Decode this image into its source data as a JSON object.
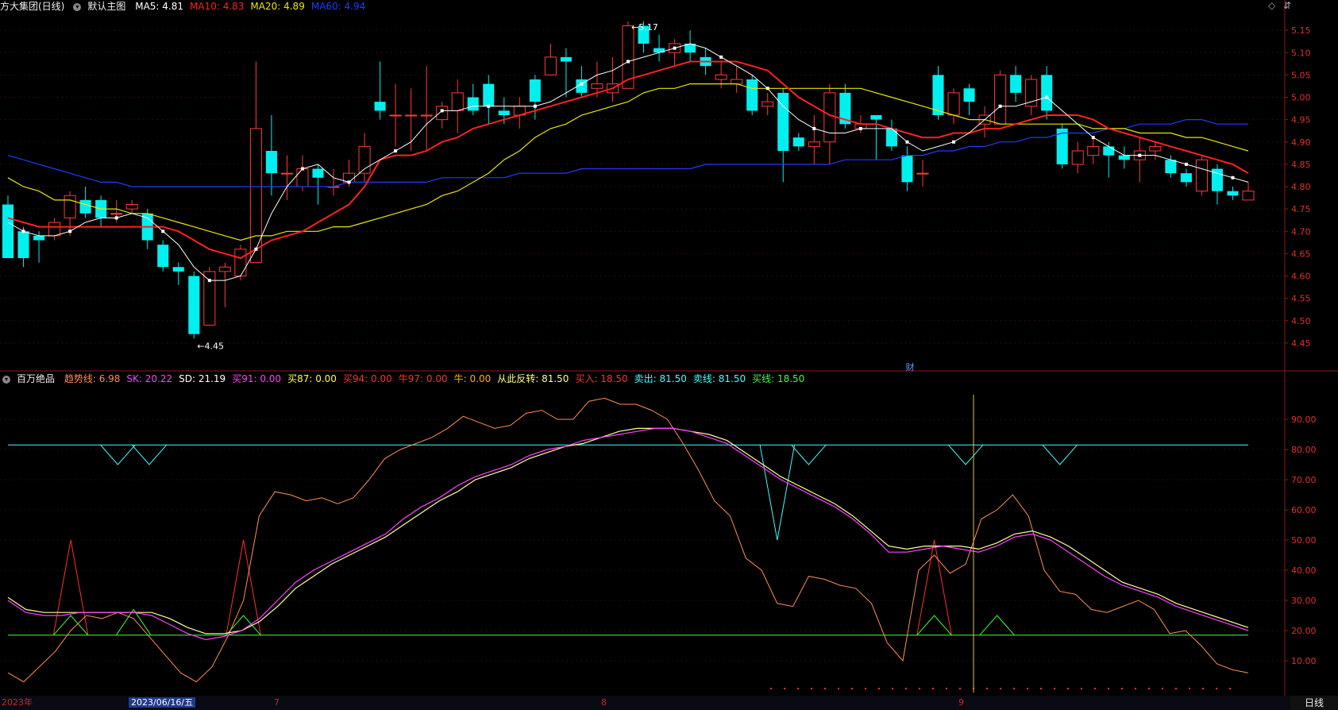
{
  "header_top": {
    "stock_title": "方大集团(日线)",
    "template_label": "默认主图",
    "ma_items": [
      {
        "text": "MA5: 4.81",
        "color": "#ffffff"
      },
      {
        "text": "MA10: 4.83",
        "color": "#ff2020"
      },
      {
        "text": "MA20: 4.89",
        "color": "#e8e800"
      },
      {
        "text": "MA60: 4.94",
        "color": "#1e3cff"
      }
    ],
    "icons": [
      "◇",
      "⇵"
    ]
  },
  "header_bottom": {
    "indicator_name": "百万绝品",
    "items": [
      {
        "text": "趋势线: 6.98",
        "color": "#ff8c5a"
      },
      {
        "text": "SK: 20.22",
        "color": "#ff40ff"
      },
      {
        "text": "SD: 21.19",
        "color": "#ffffff"
      },
      {
        "text": "买91: 0.00",
        "color": "#ff40ff"
      },
      {
        "text": "买87: 0.00",
        "color": "#ffff40"
      },
      {
        "text": "买94: 0.00",
        "color": "#ff3030"
      },
      {
        "text": "牛97: 0.00",
        "color": "#ff3030"
      },
      {
        "text": "牛: 0.00",
        "color": "#ffb000"
      },
      {
        "text": "从此反转: 81.50",
        "color": "#ffff80"
      },
      {
        "text": "买入: 18.50",
        "color": "#ff3030"
      },
      {
        "text": "卖出: 81.50",
        "color": "#40ffff"
      },
      {
        "text": "卖线: 81.50",
        "color": "#40ffff"
      },
      {
        "text": "买线: 18.50",
        "color": "#40ff40"
      }
    ]
  },
  "bottom_axis": {
    "labels": [
      "2023年",
      "2023/06/16/五",
      "7",
      "8",
      "9"
    ],
    "period_button": "日线"
  },
  "annotations": {
    "high": "5.17",
    "low": "4.45",
    "fin_marker": "财"
  },
  "chart_data": [
    {
      "type": "candlestick",
      "ylim": [
        4.4,
        5.2
      ],
      "y_ticks": [
        "5.15",
        "5.10",
        "5.05",
        "5.00",
        "4.95",
        "4.90",
        "4.85",
        "4.80",
        "4.75",
        "4.70",
        "4.65",
        "4.60",
        "4.55",
        "4.50",
        "4.45"
      ],
      "candles": [
        [
          4.76,
          4.64,
          4.78,
          4.64
        ],
        [
          4.7,
          4.64,
          4.71,
          4.62
        ],
        [
          4.69,
          4.68,
          4.7,
          4.63
        ],
        [
          4.69,
          4.72,
          4.73,
          4.68
        ],
        [
          4.73,
          4.78,
          4.79,
          4.69
        ],
        [
          4.77,
          4.74,
          4.8,
          4.73
        ],
        [
          4.77,
          4.73,
          4.78,
          4.71
        ],
        [
          4.74,
          4.74,
          4.77,
          4.72
        ],
        [
          4.75,
          4.76,
          4.77,
          4.74
        ],
        [
          4.74,
          4.68,
          4.75,
          4.66
        ],
        [
          4.67,
          4.62,
          4.68,
          4.61
        ],
        [
          4.62,
          4.61,
          4.63,
          4.58
        ],
        [
          4.6,
          4.47,
          4.61,
          4.46
        ],
        [
          4.49,
          4.61,
          4.62,
          4.49
        ],
        [
          4.61,
          4.62,
          4.63,
          4.53
        ],
        [
          4.6,
          4.66,
          4.67,
          4.59
        ],
        [
          4.63,
          4.93,
          5.08,
          4.63
        ],
        [
          4.88,
          4.83,
          4.96,
          4.78
        ],
        [
          4.83,
          4.83,
          4.87,
          4.77
        ],
        [
          4.8,
          4.84,
          4.87,
          4.79
        ],
        [
          4.84,
          4.82,
          4.85,
          4.76
        ],
        [
          4.8,
          4.8,
          4.84,
          4.78
        ],
        [
          4.81,
          4.83,
          4.86,
          4.8
        ],
        [
          4.83,
          4.89,
          4.92,
          4.81
        ],
        [
          4.99,
          4.97,
          5.08,
          4.95
        ],
        [
          4.96,
          4.96,
          5.03,
          4.89
        ],
        [
          4.96,
          4.96,
          5.02,
          4.88
        ],
        [
          4.96,
          4.96,
          5.07,
          4.88
        ],
        [
          4.95,
          4.98,
          4.99,
          4.93
        ],
        [
          4.97,
          5.01,
          5.04,
          4.92
        ],
        [
          5.0,
          4.97,
          5.03,
          4.96
        ],
        [
          5.03,
          4.98,
          5.05,
          4.94
        ],
        [
          4.97,
          4.96,
          5.0,
          4.94
        ],
        [
          4.96,
          4.98,
          5.0,
          4.93
        ],
        [
          5.04,
          4.99,
          5.05,
          4.95
        ],
        [
          5.05,
          5.09,
          5.12,
          5.05
        ],
        [
          5.09,
          5.08,
          5.11,
          5.0
        ],
        [
          5.04,
          5.01,
          5.07,
          5.0
        ],
        [
          5.02,
          5.03,
          5.08,
          5.0
        ],
        [
          5.01,
          5.03,
          5.09,
          4.99
        ],
        [
          5.02,
          5.16,
          5.17,
          5.02
        ],
        [
          5.16,
          5.12,
          5.17,
          5.1
        ],
        [
          5.11,
          5.1,
          5.14,
          5.08
        ],
        [
          5.1,
          5.12,
          5.13,
          5.07
        ],
        [
          5.12,
          5.1,
          5.15,
          5.08
        ],
        [
          5.09,
          5.07,
          5.11,
          5.05
        ],
        [
          5.04,
          5.05,
          5.08,
          5.02
        ],
        [
          5.03,
          5.04,
          5.07,
          5.01
        ],
        [
          5.04,
          4.97,
          5.05,
          4.96
        ],
        [
          4.98,
          4.99,
          5.01,
          4.96
        ],
        [
          5.01,
          4.88,
          5.02,
          4.81
        ],
        [
          4.91,
          4.89,
          4.92,
          4.88
        ],
        [
          4.89,
          4.9,
          4.96,
          4.85
        ],
        [
          4.9,
          5.01,
          5.03,
          4.85
        ],
        [
          5.01,
          4.94,
          5.03,
          4.93
        ],
        [
          4.93,
          4.94,
          4.96,
          4.92
        ],
        [
          4.96,
          4.95,
          4.96,
          4.86
        ],
        [
          4.93,
          4.89,
          4.95,
          4.88
        ],
        [
          4.87,
          4.81,
          4.89,
          4.79
        ],
        [
          4.83,
          4.83,
          4.86,
          4.8
        ],
        [
          5.05,
          4.96,
          5.07,
          4.95
        ],
        [
          4.96,
          5.01,
          5.02,
          4.94
        ],
        [
          5.02,
          4.99,
          5.03,
          4.96
        ],
        [
          4.94,
          4.96,
          4.98,
          4.91
        ],
        [
          4.94,
          5.05,
          5.06,
          4.94
        ],
        [
          5.05,
          5.01,
          5.07,
          4.99
        ],
        [
          4.98,
          5.04,
          5.05,
          4.96
        ],
        [
          5.05,
          4.97,
          5.07,
          4.95
        ],
        [
          4.93,
          4.85,
          4.94,
          4.84
        ],
        [
          4.85,
          4.88,
          4.9,
          4.83
        ],
        [
          4.87,
          4.89,
          4.91,
          4.85
        ],
        [
          4.89,
          4.87,
          4.9,
          4.82
        ],
        [
          4.87,
          4.86,
          4.89,
          4.84
        ],
        [
          4.86,
          4.88,
          4.91,
          4.81
        ],
        [
          4.88,
          4.89,
          4.9,
          4.86
        ],
        [
          4.86,
          4.83,
          4.87,
          4.82
        ],
        [
          4.83,
          4.81,
          4.84,
          4.8
        ],
        [
          4.79,
          4.86,
          4.87,
          4.78
        ],
        [
          4.84,
          4.79,
          4.85,
          4.76
        ],
        [
          4.79,
          4.78,
          4.8,
          4.77
        ],
        [
          4.77,
          4.79,
          4.81,
          4.77
        ]
      ],
      "ma5": [
        4.72,
        4.7,
        4.69,
        4.69,
        4.7,
        4.72,
        4.73,
        4.73,
        4.74,
        4.73,
        4.7,
        4.67,
        4.62,
        4.59,
        4.59,
        4.6,
        4.66,
        4.74,
        4.8,
        4.84,
        4.85,
        4.82,
        4.81,
        4.84,
        4.86,
        4.88,
        4.9,
        4.94,
        4.97,
        4.97,
        4.98,
        4.98,
        4.98,
        4.98,
        4.98,
        4.99,
        5.01,
        5.03,
        5.05,
        5.06,
        5.08,
        5.09,
        5.1,
        5.11,
        5.12,
        5.11,
        5.09,
        5.07,
        5.05,
        5.02,
        4.98,
        4.95,
        4.93,
        4.92,
        4.92,
        4.93,
        4.93,
        4.93,
        4.9,
        4.88,
        4.89,
        4.9,
        4.92,
        4.95,
        4.98,
        4.98,
        4.99,
        5.0,
        4.97,
        4.94,
        4.91,
        4.89,
        4.87,
        4.87,
        4.87,
        4.86,
        4.85,
        4.84,
        4.83,
        4.82,
        4.81
      ],
      "ma10": [
        4.73,
        4.72,
        4.71,
        4.71,
        4.71,
        4.71,
        4.71,
        4.71,
        4.71,
        4.71,
        4.71,
        4.7,
        4.68,
        4.66,
        4.65,
        4.64,
        4.66,
        4.68,
        4.69,
        4.7,
        4.72,
        4.74,
        4.76,
        4.8,
        4.86,
        4.87,
        4.87,
        4.88,
        4.9,
        4.91,
        4.93,
        4.94,
        4.95,
        4.96,
        4.97,
        4.98,
        4.99,
        5.0,
        5.01,
        5.02,
        5.04,
        5.05,
        5.06,
        5.07,
        5.08,
        5.08,
        5.08,
        5.08,
        5.07,
        5.06,
        5.03,
        5.0,
        4.98,
        4.96,
        4.95,
        4.94,
        4.94,
        4.93,
        4.92,
        4.91,
        4.91,
        4.92,
        4.92,
        4.93,
        4.93,
        4.94,
        4.95,
        4.96,
        4.96,
        4.96,
        4.95,
        4.93,
        4.92,
        4.91,
        4.9,
        4.89,
        4.88,
        4.87,
        4.86,
        4.85,
        4.83
      ],
      "ma20": [
        4.82,
        4.8,
        4.79,
        4.77,
        4.77,
        4.76,
        4.75,
        4.75,
        4.74,
        4.74,
        4.73,
        4.72,
        4.71,
        4.7,
        4.69,
        4.68,
        4.69,
        4.69,
        4.7,
        4.7,
        4.7,
        4.71,
        4.71,
        4.72,
        4.73,
        4.74,
        4.75,
        4.76,
        4.78,
        4.79,
        4.81,
        4.83,
        4.86,
        4.88,
        4.91,
        4.93,
        4.94,
        4.96,
        4.97,
        4.98,
        4.99,
        5.01,
        5.02,
        5.02,
        5.03,
        5.03,
        5.03,
        5.03,
        5.02,
        5.02,
        5.02,
        5.02,
        5.02,
        5.02,
        5.02,
        5.02,
        5.01,
        5.0,
        4.99,
        4.98,
        4.97,
        4.96,
        4.95,
        4.95,
        4.94,
        4.94,
        4.94,
        4.94,
        4.94,
        4.94,
        4.93,
        4.93,
        4.93,
        4.92,
        4.92,
        4.92,
        4.91,
        4.91,
        4.9,
        4.89,
        4.88
      ],
      "ma60": [
        4.87,
        4.86,
        4.85,
        4.84,
        4.83,
        4.82,
        4.81,
        4.81,
        4.8,
        4.8,
        4.8,
        4.8,
        4.8,
        4.8,
        4.8,
        4.8,
        4.8,
        4.8,
        4.8,
        4.8,
        4.8,
        4.8,
        4.81,
        4.81,
        4.81,
        4.81,
        4.81,
        4.81,
        4.82,
        4.82,
        4.82,
        4.82,
        4.82,
        4.83,
        4.83,
        4.83,
        4.83,
        4.84,
        4.84,
        4.84,
        4.84,
        4.84,
        4.84,
        4.84,
        4.84,
        4.85,
        4.85,
        4.85,
        4.85,
        4.85,
        4.85,
        4.85,
        4.85,
        4.85,
        4.86,
        4.86,
        4.86,
        4.86,
        4.87,
        4.87,
        4.88,
        4.88,
        4.89,
        4.89,
        4.9,
        4.9,
        4.91,
        4.91,
        4.92,
        4.92,
        4.92,
        4.93,
        4.93,
        4.94,
        4.94,
        4.94,
        4.95,
        4.95,
        4.94,
        4.94,
        4.94
      ]
    },
    {
      "type": "line",
      "ylim": [
        0,
        100
      ],
      "y_ticks": [
        "90.00",
        "80.00",
        "70.00",
        "60.00",
        "50.00",
        "40.00",
        "30.00",
        "20.00",
        "10.00"
      ],
      "trend_line": [
        6,
        3,
        8,
        13,
        20,
        25,
        24,
        26,
        24,
        18,
        12,
        6,
        3,
        8,
        18,
        30,
        58,
        66,
        65,
        63,
        64,
        62,
        64,
        70,
        77,
        80,
        82,
        84,
        87,
        91,
        89,
        87,
        88,
        92,
        93,
        90,
        90,
        96,
        97,
        95,
        95,
        93,
        90,
        82,
        73,
        63,
        58,
        44,
        40,
        29,
        28,
        38,
        37,
        35,
        34,
        29,
        16,
        10,
        40,
        45,
        39,
        42,
        57,
        60,
        65,
        58,
        40,
        33,
        32,
        27,
        26,
        28,
        30,
        27,
        19,
        20,
        15,
        9,
        7,
        6
      ],
      "sk": [
        30,
        26,
        25,
        25,
        26,
        26,
        26,
        26,
        25,
        22,
        19,
        17,
        18,
        20,
        24,
        30,
        36,
        40,
        43,
        46,
        49,
        52,
        57,
        61,
        64,
        68,
        71,
        73,
        75,
        78,
        80,
        81,
        83,
        84,
        85,
        86,
        87,
        87,
        86,
        84,
        82,
        78,
        74,
        70,
        67,
        64,
        61,
        57,
        52,
        46,
        46,
        47,
        48,
        47,
        46,
        48,
        51,
        52,
        50,
        46,
        42,
        38,
        35,
        33,
        31,
        28,
        26,
        24,
        22,
        20
      ],
      "sd": [
        31,
        27,
        26,
        26,
        26,
        26,
        26,
        26,
        26,
        24,
        21,
        19,
        19,
        20,
        23,
        28,
        34,
        38,
        42,
        45,
        48,
        51,
        55,
        59,
        63,
        66,
        70,
        72,
        74,
        77,
        79,
        81,
        82,
        84,
        86,
        87,
        87,
        87,
        86,
        85,
        83,
        79,
        75,
        71,
        68,
        65,
        62,
        58,
        53,
        48,
        47,
        48,
        48,
        48,
        47,
        49,
        52,
        53,
        51,
        48,
        44,
        40,
        36,
        34,
        32,
        29,
        27,
        25,
        23,
        21
      ],
      "sell_line": 81.5,
      "buy_line": 18.5,
      "sell_spikes": [
        [
          7,
          75
        ],
        [
          9,
          75
        ],
        [
          49,
          50
        ],
        [
          51,
          75
        ],
        [
          61,
          75
        ],
        [
          67,
          75
        ]
      ],
      "buy_spikes": [
        [
          4,
          50
        ],
        [
          15,
          50
        ],
        [
          59,
          50
        ]
      ],
      "green_spikes": [
        [
          4,
          25
        ],
        [
          8,
          27
        ],
        [
          15,
          25
        ],
        [
          59,
          25
        ],
        [
          63,
          25
        ]
      ]
    }
  ]
}
